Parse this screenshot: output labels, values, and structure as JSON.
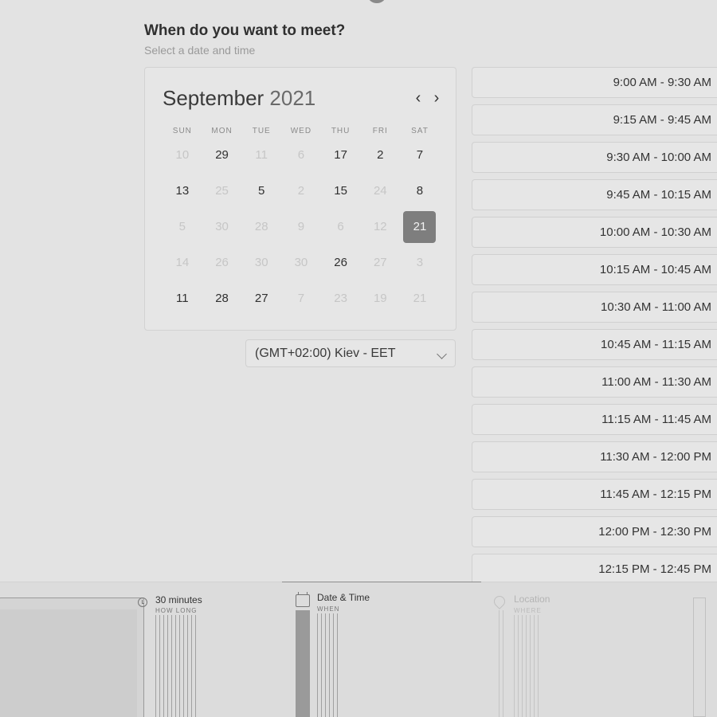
{
  "header": {
    "title": "When do you want to meet?",
    "subtitle": "Select a date and time"
  },
  "calendar": {
    "month": "September",
    "year": "2021",
    "weekdays": [
      "SUN",
      "MON",
      "TUE",
      "WED",
      "THU",
      "FRI",
      "SAT"
    ],
    "weeks": [
      [
        {
          "d": "10",
          "a": false
        },
        {
          "d": "29",
          "a": true
        },
        {
          "d": "11",
          "a": false
        },
        {
          "d": "6",
          "a": false
        },
        {
          "d": "17",
          "a": true
        },
        {
          "d": "2",
          "a": true
        },
        {
          "d": "7",
          "a": true
        }
      ],
      [
        {
          "d": "13",
          "a": true
        },
        {
          "d": "25",
          "a": false
        },
        {
          "d": "5",
          "a": true
        },
        {
          "d": "2",
          "a": false
        },
        {
          "d": "15",
          "a": true
        },
        {
          "d": "24",
          "a": false
        },
        {
          "d": "8",
          "a": true
        }
      ],
      [
        {
          "d": "5",
          "a": false
        },
        {
          "d": "30",
          "a": false
        },
        {
          "d": "28",
          "a": false
        },
        {
          "d": "9",
          "a": false
        },
        {
          "d": "6",
          "a": false
        },
        {
          "d": "12",
          "a": false
        },
        {
          "d": "21",
          "a": true,
          "selected": true
        }
      ],
      [
        {
          "d": "14",
          "a": false
        },
        {
          "d": "26",
          "a": false
        },
        {
          "d": "30",
          "a": false
        },
        {
          "d": "30",
          "a": false
        },
        {
          "d": "26",
          "a": true
        },
        {
          "d": "27",
          "a": false
        },
        {
          "d": "3",
          "a": false
        }
      ],
      [
        {
          "d": "11",
          "a": true
        },
        {
          "d": "28",
          "a": true
        },
        {
          "d": "27",
          "a": true
        },
        {
          "d": "7",
          "a": false
        },
        {
          "d": "23",
          "a": false
        },
        {
          "d": "19",
          "a": false
        },
        {
          "d": "21",
          "a": false
        }
      ]
    ],
    "prev_icon": "chevron-left-icon",
    "next_icon": "chevron-right-icon"
  },
  "timezone": {
    "selected": "(GMT+02:00) Kiev - EET",
    "icon": "chevron-down-icon"
  },
  "time_slots": [
    "9:00 AM - 9:30 AM",
    "9:15 AM - 9:45 AM",
    "9:30 AM - 10:00 AM",
    "9:45 AM - 10:15 AM",
    "10:00 AM - 10:30 AM",
    "10:15 AM - 10:45 AM",
    "10:30 AM - 11:00 AM",
    "10:45 AM - 11:15 AM",
    "11:00 AM - 11:30 AM",
    "11:15 AM - 11:45 AM",
    "11:30 AM - 12:00 PM",
    "11:45 AM - 12:15 PM",
    "12:00 PM - 12:30 PM",
    "12:15 PM - 12:45 PM"
  ],
  "steps": [
    {
      "label": "30 minutes",
      "sub": "HOW LONG",
      "icon": "clock-icon",
      "active": false
    },
    {
      "label": "Date & Time",
      "sub": "WHEN",
      "icon": "calendar-icon",
      "active": true
    },
    {
      "label": "Location",
      "sub": "WHERE",
      "icon": "map-pin-icon",
      "active": false
    }
  ]
}
